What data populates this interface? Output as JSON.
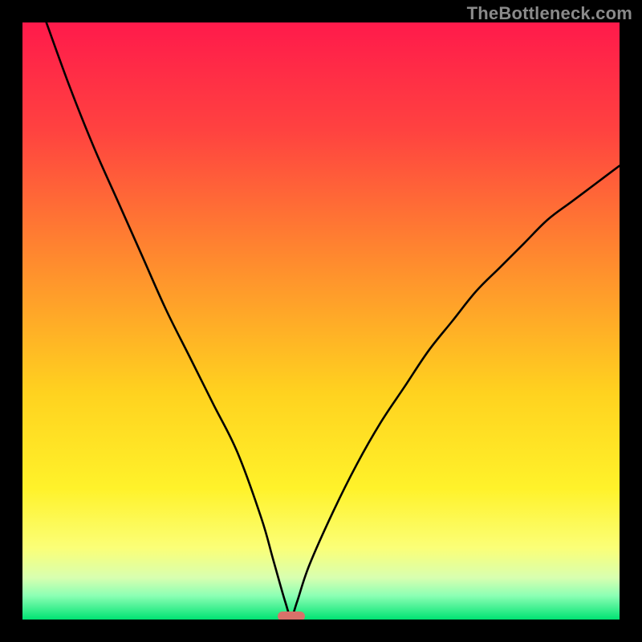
{
  "watermark": "TheBottleneck.com",
  "chart_data": {
    "type": "line",
    "title": "",
    "xlabel": "",
    "ylabel": "",
    "xlim": [
      0,
      100
    ],
    "ylim": [
      0,
      100
    ],
    "grid": false,
    "series": [
      {
        "name": "bottleneck-curve",
        "color": "#000000",
        "x": [
          4,
          8,
          12,
          16,
          20,
          24,
          28,
          32,
          36,
          40,
          42,
          44,
          45,
          46,
          48,
          52,
          56,
          60,
          64,
          68,
          72,
          76,
          80,
          84,
          88,
          92,
          96,
          100
        ],
        "y": [
          100,
          89,
          79,
          70,
          61,
          52,
          44,
          36,
          28,
          17,
          10,
          3,
          0.5,
          3,
          9,
          18,
          26,
          33,
          39,
          45,
          50,
          55,
          59,
          63,
          67,
          70,
          73,
          76
        ]
      }
    ],
    "min_marker": {
      "x": 45,
      "y": 0.5,
      "color": "#d9716a"
    },
    "background_gradient_stops": [
      {
        "pct": 0,
        "color": "#ff1a4b"
      },
      {
        "pct": 18,
        "color": "#ff4240"
      },
      {
        "pct": 40,
        "color": "#ff8b2e"
      },
      {
        "pct": 62,
        "color": "#ffd21f"
      },
      {
        "pct": 78,
        "color": "#fff22a"
      },
      {
        "pct": 88,
        "color": "#fbff77"
      },
      {
        "pct": 93,
        "color": "#d8ffb0"
      },
      {
        "pct": 96,
        "color": "#8cffb4"
      },
      {
        "pct": 100,
        "color": "#00e373"
      }
    ]
  }
}
